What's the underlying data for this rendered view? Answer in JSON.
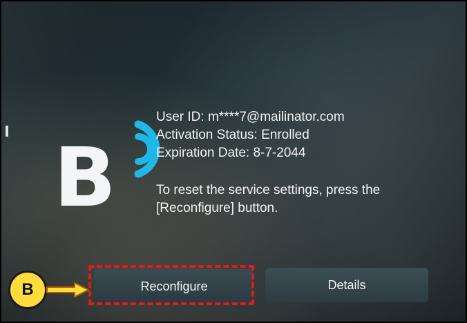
{
  "info": {
    "user_id": "User ID: m****7@mailinator.com",
    "activation_status": "Activation Status: Enrolled",
    "expiration_date": "Expiration Date: 8-7-2044",
    "reset_line1": "To reset the service settings, press the",
    "reset_line2": "[Reconfigure] button."
  },
  "logo": {
    "letter": "B",
    "icon": "signal-waves-icon",
    "accent_color": "#1fb6e8"
  },
  "buttons": {
    "reconfigure": "Reconfigure",
    "details": "Details"
  },
  "annotation": {
    "callout_label": "B",
    "highlight_color": "#e11a1a",
    "callout_color": "#ffdc3c"
  }
}
